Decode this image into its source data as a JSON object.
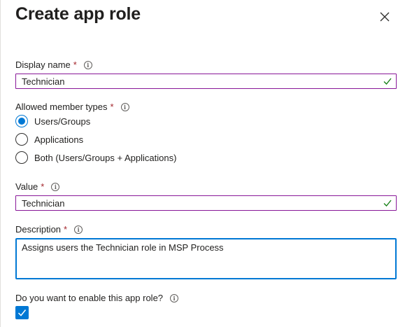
{
  "header": {
    "title": "Create app role"
  },
  "display_name": {
    "label": "Display name",
    "required_mark": "*",
    "value": "Technician"
  },
  "member_types": {
    "label": "Allowed member types",
    "required_mark": "*",
    "options": [
      {
        "label": "Users/Groups",
        "selected": true
      },
      {
        "label": "Applications",
        "selected": false
      },
      {
        "label": "Both (Users/Groups + Applications)",
        "selected": false
      }
    ]
  },
  "value_field": {
    "label": "Value",
    "required_mark": "*",
    "value": "Technician"
  },
  "description": {
    "label": "Description",
    "required_mark": "*",
    "value": "Assigns users the Technician role in MSP Process"
  },
  "enable": {
    "label": "Do you want to enable this app role?",
    "checked": true
  },
  "colors": {
    "accent": "#0078d4",
    "valid_border": "#881798",
    "valid_check": "#107c10",
    "required": "#a4262c"
  }
}
